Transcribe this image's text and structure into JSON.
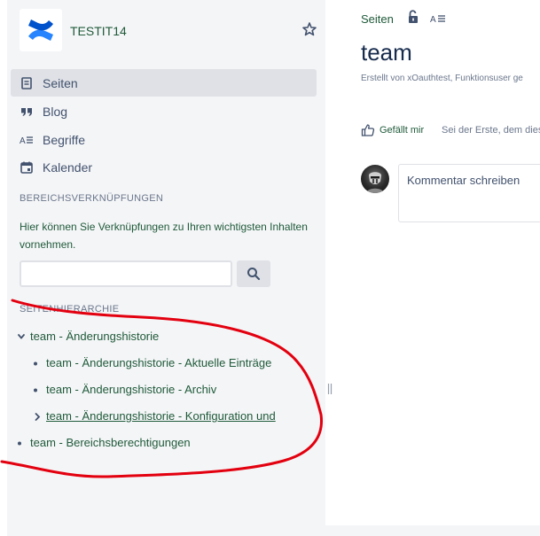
{
  "space": {
    "name": "TESTIT14",
    "logo_icon": "confluence-logo-icon",
    "brand_color": "#2684ff"
  },
  "sidebar": {
    "nav": [
      {
        "label": "Seiten",
        "icon": "pages-icon",
        "active": true
      },
      {
        "label": "Blog",
        "icon": "blog-quote-icon",
        "active": false
      },
      {
        "label": "Begriffe",
        "icon": "glossary-icon",
        "active": false
      },
      {
        "label": "Kalender",
        "icon": "calendar-icon",
        "active": false
      }
    ],
    "shortcuts": {
      "title": "BEREICHSVERKNÜPFUNGEN",
      "description": "Hier können Sie Verknüpfungen zu Ihren wichtigsten Inhalten vornehmen."
    },
    "search": {
      "value": "",
      "placeholder": ""
    },
    "hierarchy": {
      "title": "SEITENHIERARCHIE",
      "items": [
        {
          "label": "team - Änderungshistorie",
          "marker": "chevron-down"
        },
        {
          "label": "team - Änderungshistorie - Aktuelle Einträge",
          "marker": "bullet"
        },
        {
          "label": "team - Änderungshistorie - Archiv",
          "marker": "bullet"
        },
        {
          "label": "team - Änderungshistorie - Konfiguration und",
          "marker": "chevron-right"
        },
        {
          "label": "team - Bereichsberechtigungen",
          "marker": "bullet"
        }
      ]
    }
  },
  "main": {
    "breadcrumb": "Seiten",
    "title": "team",
    "byline": "Erstellt von xOauthtest, Funktionsuser ge",
    "like_label": "Gefällt mir",
    "like_hint": "Sei der Erste, dem dies",
    "comment_placeholder": "Kommentar schreiben"
  },
  "colors": {
    "link_green": "#1f5a3a",
    "sidebar_bg": "#f4f5f7",
    "active_bg": "#dfe1e6",
    "annotation_red": "#e3000f"
  }
}
